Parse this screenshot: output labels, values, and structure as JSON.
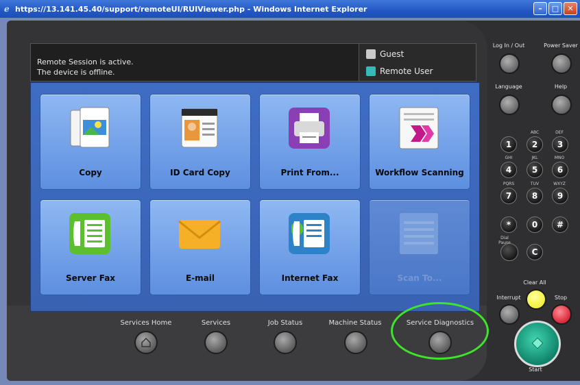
{
  "window": {
    "title": "https://13.141.45.40/support/remoteUI/RUIViewer.php - Windows Internet Explorer"
  },
  "status": {
    "line1": "Remote Session is active.",
    "line2": "The device is offline."
  },
  "user": {
    "guest": "Guest",
    "remote": "Remote User"
  },
  "tiles": [
    {
      "label": "Copy",
      "icon": "copy-icon",
      "enabled": true
    },
    {
      "label": "ID Card Copy",
      "icon": "id-card-icon",
      "enabled": true
    },
    {
      "label": "Print From...",
      "icon": "printer-icon",
      "enabled": true
    },
    {
      "label": "Workflow Scanning",
      "icon": "workflow-scan-icon",
      "enabled": true
    },
    {
      "label": "Server Fax",
      "icon": "server-fax-icon",
      "enabled": true
    },
    {
      "label": "E-mail",
      "icon": "envelope-icon",
      "enabled": true
    },
    {
      "label": "Internet Fax",
      "icon": "internet-fax-icon",
      "enabled": true
    },
    {
      "label": "Scan To...",
      "icon": "scan-to-icon",
      "enabled": false
    }
  ],
  "bottom_buttons": [
    {
      "label": "Services Home"
    },
    {
      "label": "Services"
    },
    {
      "label": "Job Status"
    },
    {
      "label": "Machine Status"
    },
    {
      "label": "Service Diagnostics"
    }
  ],
  "right_panel": {
    "login": "Log In / Out",
    "power_saver": "Power Saver",
    "language": "Language",
    "help": "Help",
    "dial_pause": "Dial Pause",
    "clear_all": "Clear All",
    "interrupt": "Interrupt",
    "stop": "Stop",
    "start": "Start",
    "keys": {
      "k1": "1",
      "k2": "2",
      "k3": "3",
      "k4": "4",
      "k5": "5",
      "k6": "6",
      "k7": "7",
      "k8": "8",
      "k9": "9",
      "star": "*",
      "k0": "0",
      "hash": "#",
      "c": "C"
    },
    "subs": {
      "abc": "ABC",
      "def": "DEF",
      "ghi": "GHI",
      "jkl": "JKL",
      "mno": "MNO",
      "pqrs": "PQRS",
      "tuv": "TUV",
      "wxyz": "WXYZ"
    }
  },
  "colors": {
    "highlight_ring": "#3ee32a",
    "screen_blue": "#3f6dc3",
    "start_green": "#1fb896",
    "clear_yellow": "#f5ef3a",
    "stop_red": "#e23a4a"
  }
}
